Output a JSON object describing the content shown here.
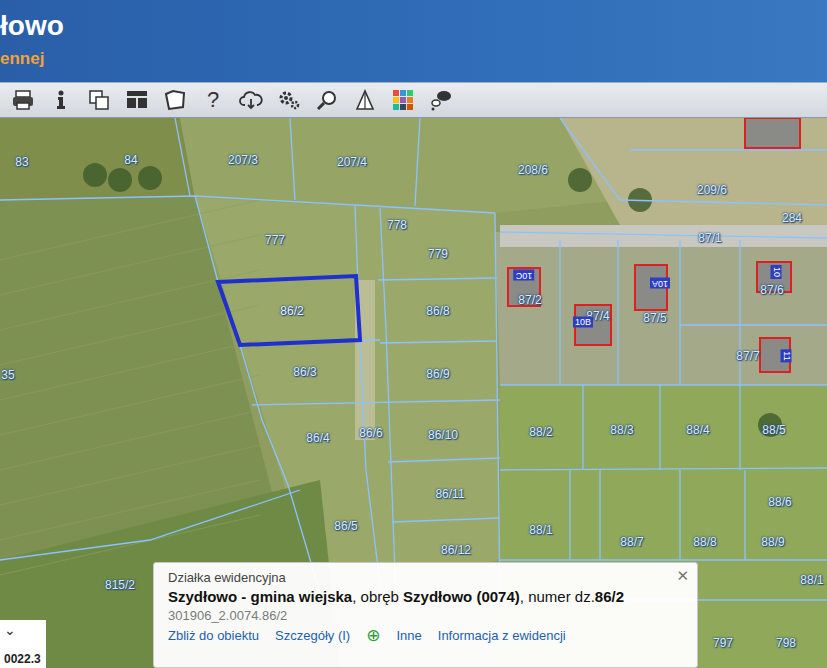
{
  "header": {
    "title": "łowo",
    "subtitle": "ennej"
  },
  "toolbar": {
    "help": "?"
  },
  "map": {
    "parcels": [
      {
        "label": "83",
        "selected": false
      },
      {
        "label": "84",
        "selected": false
      },
      {
        "label": "207/3",
        "selected": false
      },
      {
        "label": "207/4",
        "selected": false
      },
      {
        "label": "208/6",
        "selected": false
      },
      {
        "label": "209/6",
        "selected": false
      },
      {
        "label": "284",
        "selected": false
      },
      {
        "label": "86/2",
        "selected": true
      },
      {
        "label": "778",
        "selected": false
      },
      {
        "label": "777",
        "selected": false
      },
      {
        "label": "779",
        "selected": false
      },
      {
        "label": "87/1",
        "selected": false
      },
      {
        "label": "86/8",
        "selected": false
      },
      {
        "label": "87/2",
        "selected": false
      },
      {
        "label": "87/4",
        "selected": false
      },
      {
        "label": "87/5",
        "selected": false
      },
      {
        "label": "87/6",
        "selected": false
      },
      {
        "label": "86/3",
        "selected": false
      },
      {
        "label": "86/9",
        "selected": false
      },
      {
        "label": "87/7",
        "selected": false
      },
      {
        "label": "35",
        "selected": false
      },
      {
        "label": "86/4",
        "selected": false
      },
      {
        "label": "86/6",
        "selected": false
      },
      {
        "label": "86/10",
        "selected": false
      },
      {
        "label": "88/2",
        "selected": false
      },
      {
        "label": "88/3",
        "selected": false
      },
      {
        "label": "88/4",
        "selected": false
      },
      {
        "label": "88/5",
        "selected": false
      },
      {
        "label": "86/11",
        "selected": false
      },
      {
        "label": "88/6",
        "selected": false
      },
      {
        "label": "86/5",
        "selected": false
      },
      {
        "label": "86/12",
        "selected": false
      },
      {
        "label": "88/1",
        "selected": false
      },
      {
        "label": "88/7",
        "selected": false
      },
      {
        "label": "88/8",
        "selected": false
      },
      {
        "label": "88/9",
        "selected": false
      },
      {
        "label": "815/2",
        "selected": false
      },
      {
        "label": "88/1",
        "selected": false
      },
      {
        "label": "797",
        "selected": false
      },
      {
        "label": "798",
        "selected": false
      }
    ],
    "buildings": [
      {
        "label": "10C"
      },
      {
        "label": "10A"
      },
      {
        "label": "10B"
      },
      {
        "label": "10"
      },
      {
        "label": "11"
      }
    ]
  },
  "popup": {
    "type": "Działka ewidencyjna",
    "municipality": "Szydłowo - gmina wiejska",
    "precinct_prefix": ", obręb ",
    "precinct": "Szydłowo (0074)",
    "number_prefix": ", numer dz.",
    "number": "86/2",
    "id": "301906_2.0074.86/2",
    "actions": [
      "Zbliż do obiektu",
      "Szczegóły (I)",
      "⊕",
      "Inne",
      "Informacja z ewidencji"
    ],
    "close": "✕"
  },
  "scale": {
    "toggle": "⌄",
    "value": "0022.3"
  }
}
